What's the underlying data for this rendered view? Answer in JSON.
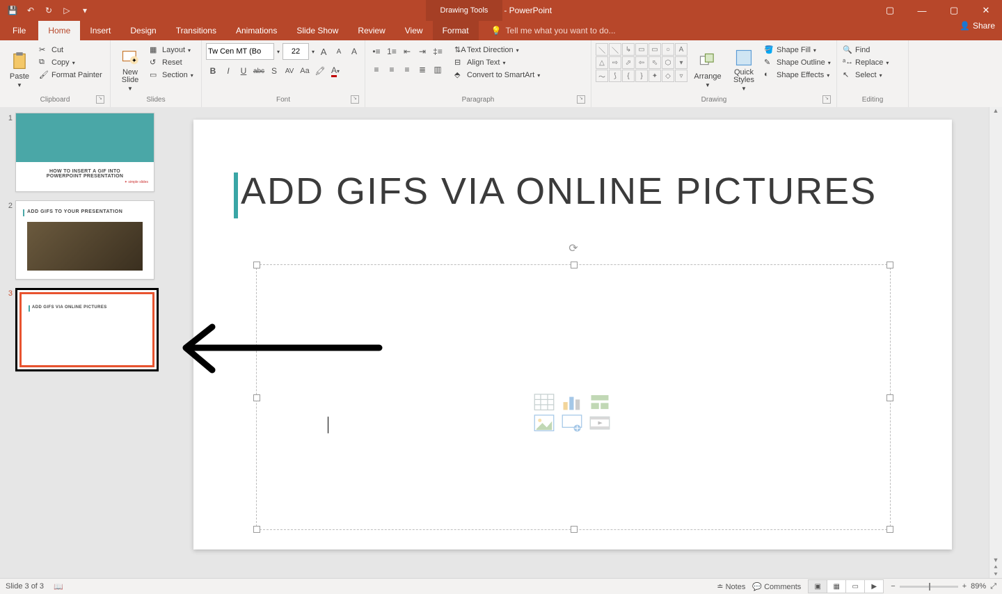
{
  "app": {
    "title": "Presentation1 - PowerPoint",
    "tool_context": "Drawing Tools"
  },
  "window": {
    "ribbon_opts": "▢",
    "min": "—",
    "max": "▢",
    "close": "✕"
  },
  "qat": {
    "save": "💾",
    "undo": "↶",
    "redo": "↻",
    "start": "▷",
    "more": "▾"
  },
  "tabs": {
    "file": "File",
    "home": "Home",
    "insert": "Insert",
    "design": "Design",
    "transitions": "Transitions",
    "animations": "Animations",
    "slideshow": "Slide Show",
    "review": "Review",
    "view": "View",
    "format": "Format",
    "tellme_placeholder": "Tell me what you want to do...",
    "share": "Share"
  },
  "ribbon": {
    "clipboard": {
      "label": "Clipboard",
      "paste": "Paste",
      "cut": "Cut",
      "copy": "Copy",
      "format_painter": "Format Painter"
    },
    "slides": {
      "label": "Slides",
      "new_slide": "New\nSlide",
      "layout": "Layout",
      "reset": "Reset",
      "section": "Section"
    },
    "font": {
      "label": "Font",
      "name": "Tw Cen MT (Bo",
      "size": "22",
      "grow": "A",
      "shrink": "A",
      "clear": "Aϕ",
      "bold": "B",
      "italic": "I",
      "underline": "U",
      "strike": "abc",
      "shadow": "S",
      "spacing": "AV",
      "case": "Aa",
      "color": "A"
    },
    "paragraph": {
      "label": "Paragraph",
      "text_direction": "Text Direction",
      "align_text": "Align Text",
      "smartart": "Convert to SmartArt"
    },
    "drawing": {
      "label": "Drawing",
      "arrange": "Arrange",
      "quick_styles": "Quick\nStyles",
      "shape_fill": "Shape Fill",
      "shape_outline": "Shape Outline",
      "shape_effects": "Shape Effects"
    },
    "editing": {
      "label": "Editing",
      "find": "Find",
      "replace": "Replace",
      "select": "Select"
    }
  },
  "thumbs": {
    "n1": "1",
    "n2": "2",
    "n3": "3",
    "t1_line1": "HOW TO INSERT A GIF INTO",
    "t1_line2": "POWERPOINT PRESENTATION",
    "t1_badge": "simple slides",
    "t2_title": "ADD GIFS TO YOUR PRESENTATION",
    "t3_title": "ADD GIFS VIA  ONLINE PICTURES"
  },
  "slide": {
    "title": "ADD GIFS VIA ONLINE PICTURES"
  },
  "status": {
    "slide_pos": "Slide 3 of 3",
    "notes": "Notes",
    "comments": "Comments",
    "zoom_pct": "89%",
    "minus": "−",
    "plus": "+",
    "fit": "⤢"
  }
}
